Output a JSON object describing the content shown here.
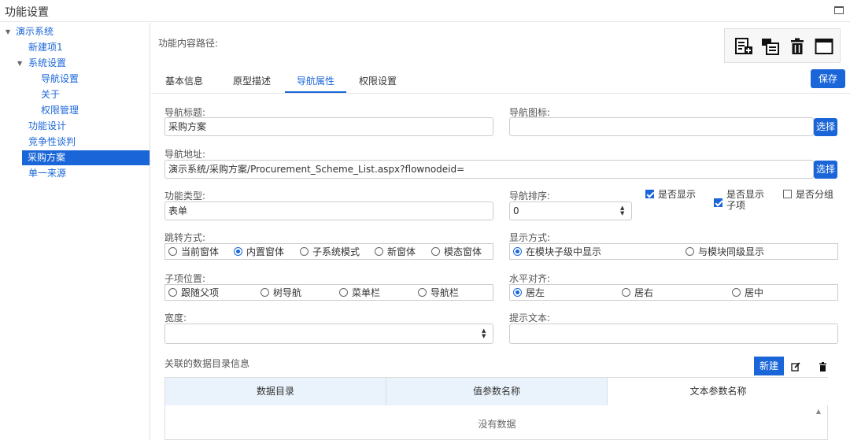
{
  "window": {
    "title": "功能设置"
  },
  "tree": {
    "root": "演示系统",
    "items": [
      {
        "label": "新建项1"
      },
      {
        "label": "系统设置"
      },
      {
        "label": "导航设置"
      },
      {
        "label": "关于"
      },
      {
        "label": "权限管理"
      },
      {
        "label": "功能设计"
      },
      {
        "label": "竞争性谈判"
      },
      {
        "label": "采购方案",
        "selected": true
      },
      {
        "label": "单一来源"
      }
    ]
  },
  "main": {
    "path_label": "功能内容路径:",
    "tabs": [
      "基本信息",
      "原型描述",
      "导航属性",
      "权限设置"
    ],
    "active_tab": "导航属性",
    "save_label": "保存"
  },
  "form": {
    "nav_title": {
      "label": "导航标题:",
      "value": "采购方案"
    },
    "nav_icon": {
      "label": "导航图标:",
      "value": "",
      "button": "选择"
    },
    "nav_url": {
      "label": "导航地址:",
      "value": "演示系统/采购方案/Procurement_Scheme_List.aspx?flownodeid=",
      "button": "选择"
    },
    "func_type": {
      "label": "功能类型:",
      "value": "表单"
    },
    "nav_order": {
      "label": "导航排序:",
      "value": "0"
    },
    "checkboxes": [
      {
        "label": "是否显示",
        "checked": true
      },
      {
        "label": "是否显示",
        "label2": "子项",
        "checked": true
      },
      {
        "label": "是否分组",
        "checked": false
      }
    ],
    "jump_mode": {
      "label": "跳转方式:",
      "options": [
        "当前窗体",
        "内置窗体",
        "子系统模式",
        "新窗体",
        "模态窗体"
      ],
      "selected": "内置窗体"
    },
    "display_mode": {
      "label": "显示方式:",
      "options": [
        "在模块子级中显示",
        "与模块同级显示"
      ],
      "selected": "在模块子级中显示"
    },
    "sub_position": {
      "label": "子项位置:",
      "options": [
        "跟随父项",
        "树导航",
        "菜单栏",
        "导航栏"
      ],
      "selected": ""
    },
    "h_align": {
      "label": "水平对齐:",
      "options": [
        "居左",
        "居右",
        "居中"
      ],
      "selected": "居左"
    },
    "width": {
      "label": "宽度:",
      "value": ""
    },
    "tip_text": {
      "label": "提示文本:",
      "value": ""
    }
  },
  "related": {
    "title": "关联的数据目录信息",
    "new_label": "新建",
    "columns": [
      "数据目录",
      "值参数名称",
      "文本参数名称"
    ],
    "empty_text": "没有数据"
  },
  "icons": [
    "add-page-icon",
    "move-page-icon",
    "trash-icon",
    "window-icon",
    "edit-icon",
    "delete-icon",
    "maximize-icon"
  ],
  "colors": {
    "primary": "#1a66d8",
    "table_header": "#eaf3fb"
  }
}
